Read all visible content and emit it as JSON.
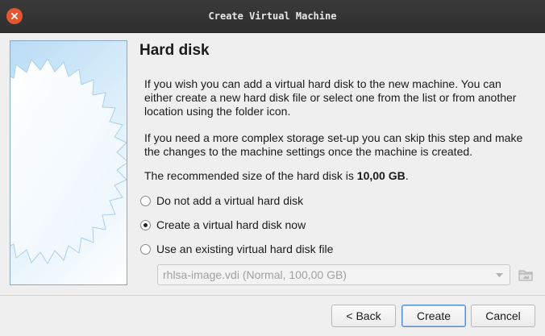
{
  "window": {
    "title": "Create Virtual Machine"
  },
  "page": {
    "heading": "Hard disk",
    "paragraph1": "If you wish you can add a virtual hard disk to the new machine. You can either create a new hard disk file or select one from the list or from another location using the folder icon.",
    "paragraph2": "If you need a more complex storage set-up you can skip this step and make the changes to the machine settings once the machine is created.",
    "recommend_prefix": "The recommended size of the hard disk is ",
    "recommend_size": "10,00 GB",
    "recommend_suffix": "."
  },
  "options": [
    {
      "label": "Do not add a virtual hard disk",
      "selected": false
    },
    {
      "label": "Create a virtual hard disk now",
      "selected": true
    },
    {
      "label": "Use an existing virtual hard disk file",
      "selected": false
    }
  ],
  "existing_disk": {
    "value": "rhlsa-image.vdi (Normal, 100,00 GB)",
    "enabled": false
  },
  "buttons": {
    "back": "< Back",
    "create": "Create",
    "cancel": "Cancel"
  },
  "colors": {
    "titlebar": "#2f2f2f",
    "close": "#e3572e",
    "default_button_border": "#4d8dd6"
  },
  "icons": {
    "close": "close-icon",
    "dropdown": "chevron-down-icon",
    "folder": "folder-icon"
  }
}
